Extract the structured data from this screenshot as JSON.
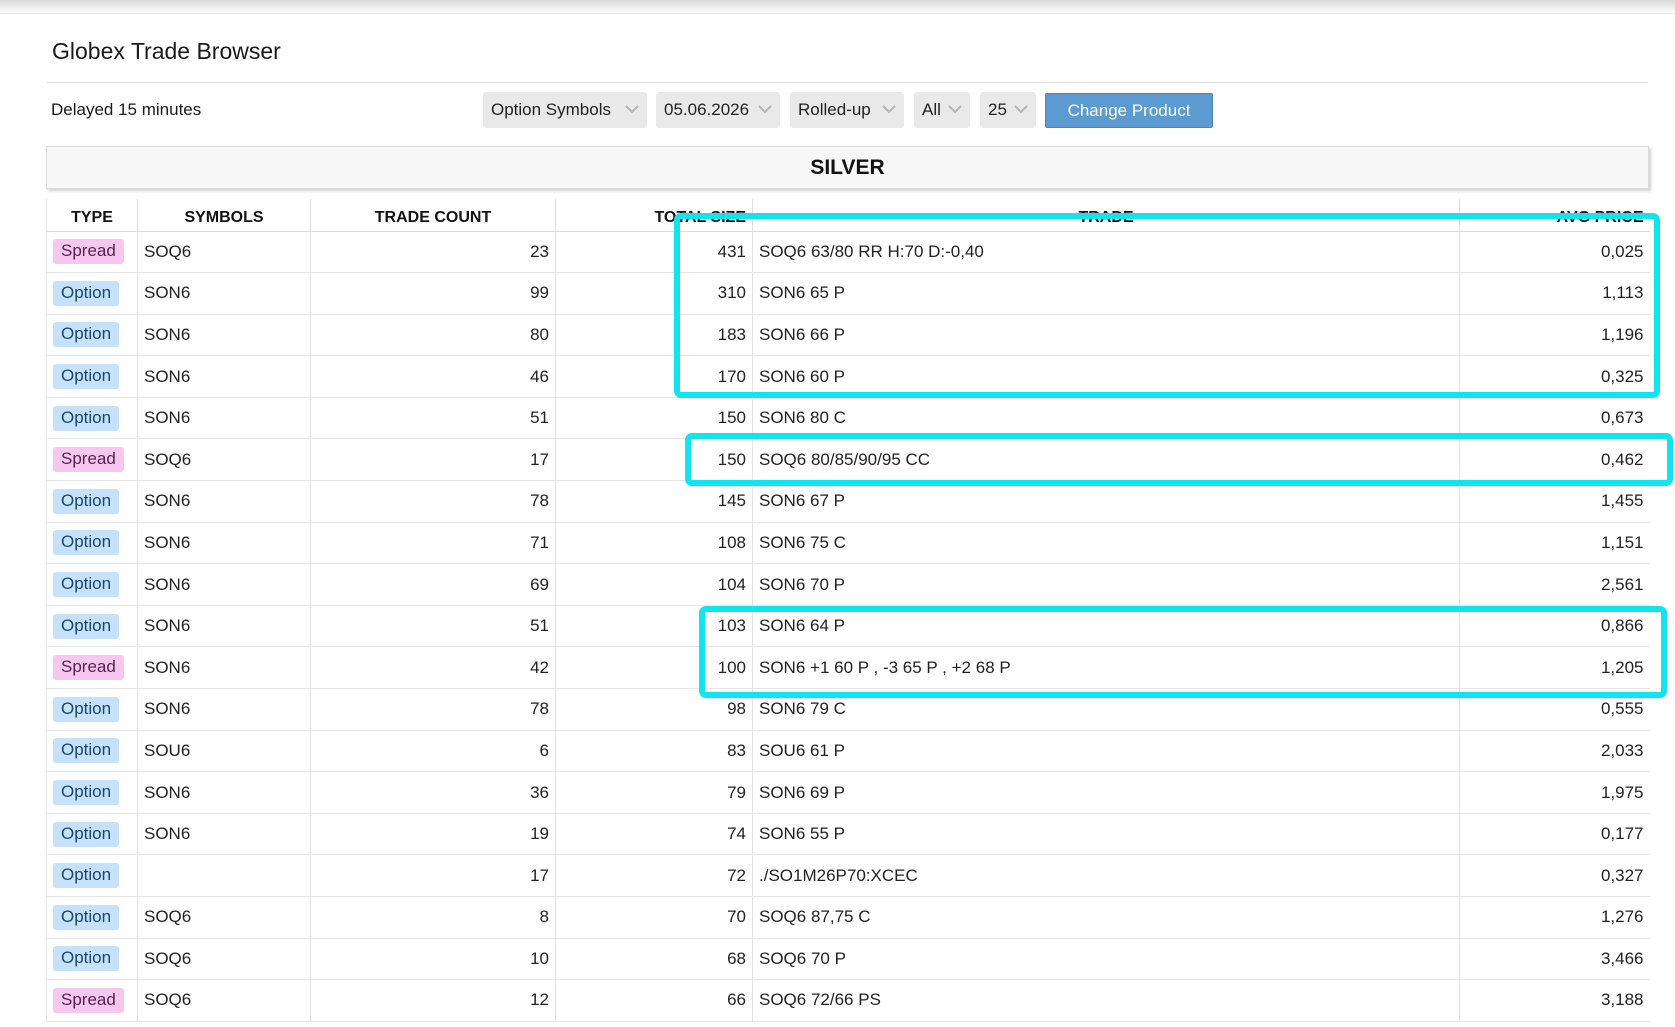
{
  "page": {
    "title": "Globex Trade Browser",
    "delay_note": "Delayed 15 minutes"
  },
  "filters": {
    "symbol_mode": "Option Symbols",
    "date": "05.06.2026",
    "grouping": "Rolled-up",
    "type": "All",
    "rows": "25",
    "change_product_label": "Change Product",
    "chevron_icon": "chevron-down-icon"
  },
  "product": {
    "name": "SILVER"
  },
  "table": {
    "columns": {
      "type": "TYPE",
      "symbols": "SYMBOLS",
      "trade_count": "TRADE COUNT",
      "total_size": "TOTAL SIZE",
      "trade": "TRADE",
      "avg_price": "AVG PRICE"
    },
    "rows": [
      {
        "type": "Spread",
        "symbol": "SOQ6",
        "count": "23",
        "size": "431",
        "trade": "SOQ6 63/80 RR H:70 D:-0,40",
        "avg": "0,025"
      },
      {
        "type": "Option",
        "symbol": "SON6",
        "count": "99",
        "size": "310",
        "trade": "SON6 65 P",
        "avg": "1,113"
      },
      {
        "type": "Option",
        "symbol": "SON6",
        "count": "80",
        "size": "183",
        "trade": "SON6 66 P",
        "avg": "1,196"
      },
      {
        "type": "Option",
        "symbol": "SON6",
        "count": "46",
        "size": "170",
        "trade": "SON6 60 P",
        "avg": "0,325"
      },
      {
        "type": "Option",
        "symbol": "SON6",
        "count": "51",
        "size": "150",
        "trade": "SON6 80 C",
        "avg": "0,673"
      },
      {
        "type": "Spread",
        "symbol": "SOQ6",
        "count": "17",
        "size": "150",
        "trade": "SOQ6 80/85/90/95 CC",
        "avg": "0,462"
      },
      {
        "type": "Option",
        "symbol": "SON6",
        "count": "78",
        "size": "145",
        "trade": "SON6 67 P",
        "avg": "1,455"
      },
      {
        "type": "Option",
        "symbol": "SON6",
        "count": "71",
        "size": "108",
        "trade": "SON6 75 C",
        "avg": "1,151"
      },
      {
        "type": "Option",
        "symbol": "SON6",
        "count": "69",
        "size": "104",
        "trade": "SON6 70 P",
        "avg": "2,561"
      },
      {
        "type": "Option",
        "symbol": "SON6",
        "count": "51",
        "size": "103",
        "trade": "SON6 64 P",
        "avg": "0,866"
      },
      {
        "type": "Spread",
        "symbol": "SON6",
        "count": "42",
        "size": "100",
        "trade": "SON6 +1 60 P , -3 65 P , +2 68 P",
        "avg": "1,205"
      },
      {
        "type": "Option",
        "symbol": "SON6",
        "count": "78",
        "size": "98",
        "trade": "SON6 79 C",
        "avg": "0,555"
      },
      {
        "type": "Option",
        "symbol": "SOU6",
        "count": "6",
        "size": "83",
        "trade": "SOU6 61 P",
        "avg": "2,033"
      },
      {
        "type": "Option",
        "symbol": "SON6",
        "count": "36",
        "size": "79",
        "trade": "SON6 69 P",
        "avg": "1,975"
      },
      {
        "type": "Option",
        "symbol": "SON6",
        "count": "19",
        "size": "74",
        "trade": "SON6 55 P",
        "avg": "0,177"
      },
      {
        "type": "Option",
        "symbol": "",
        "count": "17",
        "size": "72",
        "trade": "./SO1M26P70:XCEC",
        "avg": "0,327"
      },
      {
        "type": "Option",
        "symbol": "SOQ6",
        "count": "8",
        "size": "70",
        "trade": "SOQ6 87,75 C",
        "avg": "1,276"
      },
      {
        "type": "Option",
        "symbol": "SOQ6",
        "count": "10",
        "size": "68",
        "trade": "SOQ6 70 P",
        "avg": "3,466"
      },
      {
        "type": "Spread",
        "symbol": "SOQ6",
        "count": "12",
        "size": "66",
        "trade": "SOQ6 72/66 PS",
        "avg": "3,188"
      }
    ]
  },
  "annotation": {
    "highlight_color": "#10e4f0"
  }
}
